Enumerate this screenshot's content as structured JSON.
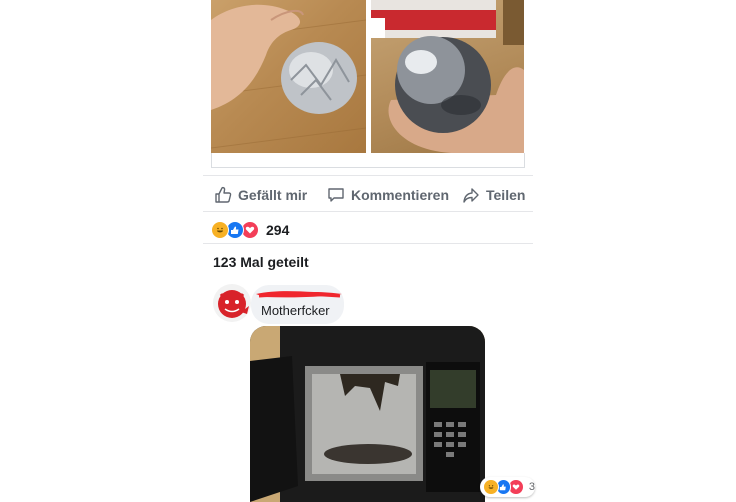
{
  "post": {
    "photos": [
      {
        "name": "foil-ball-in-hand"
      },
      {
        "name": "polished-foil-sphere"
      }
    ],
    "actions": {
      "like_label": "Gefällt mir",
      "comment_label": "Kommentieren",
      "share_label": "Teilen"
    },
    "reactions": {
      "icons": [
        "haha-icon",
        "like-icon",
        "love-icon"
      ],
      "count": "294"
    },
    "shares_label": "123 Mal geteilt"
  },
  "comment": {
    "text": "Motherfcker",
    "reactions": {
      "icons": [
        "haha-icon",
        "like-icon",
        "love-icon"
      ],
      "count": "3"
    }
  },
  "colors": {
    "like_blue": "#1877f2",
    "love_red": "#f33e58",
    "haha_yellow": "#f7b125",
    "action_gray": "#606770",
    "bubble_bg": "#f0f2f5"
  }
}
